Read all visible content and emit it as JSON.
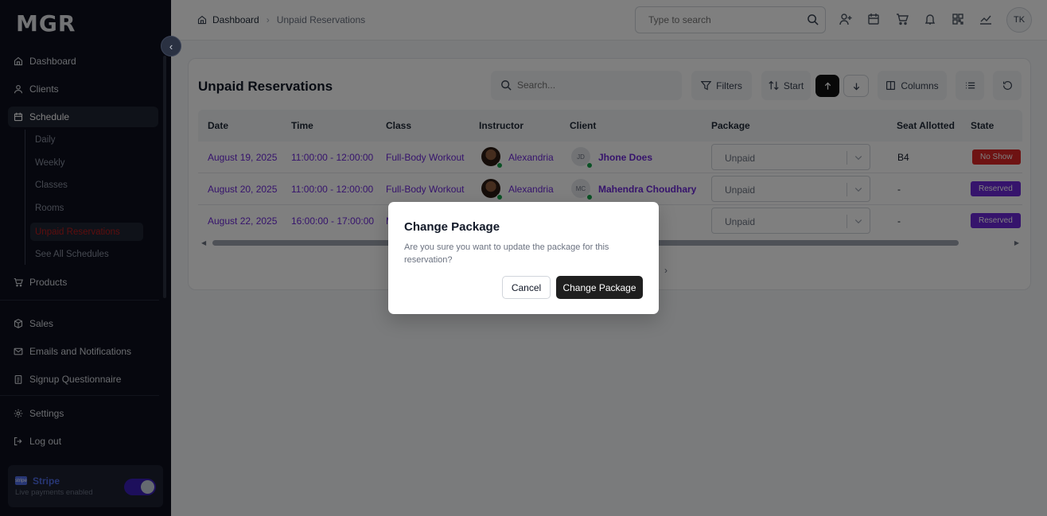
{
  "app": {
    "logo": "MGR"
  },
  "sidebar": {
    "items": [
      {
        "label": "Dashboard",
        "icon": "home-icon"
      },
      {
        "label": "Clients",
        "icon": "user-icon"
      },
      {
        "label": "Schedule",
        "icon": "calendar-icon"
      },
      {
        "label": "Products",
        "icon": "cart-icon"
      },
      {
        "label": "Sales",
        "icon": "box-icon"
      },
      {
        "label": "Emails and Notifications",
        "icon": "mail-icon"
      },
      {
        "label": "Signup Questionnaire",
        "icon": "clipboard-icon"
      },
      {
        "label": "Settings",
        "icon": "gear-icon"
      },
      {
        "label": "Log out",
        "icon": "logout-icon"
      }
    ],
    "schedule_sub": [
      "Daily",
      "Weekly",
      "Classes",
      "Rooms",
      "Unpaid Reservations",
      "See All Schedules"
    ],
    "stripe": {
      "badge": "stripe",
      "title": "Stripe",
      "subtitle": "Live payments enabled",
      "enabled": true
    }
  },
  "header": {
    "breadcrumb": {
      "root": "Dashboard",
      "current": "Unpaid Reservations"
    },
    "search_placeholder": "Type to search",
    "avatar_initials": "TK"
  },
  "main": {
    "title": "Unpaid Reservations",
    "search_placeholder": "Search...",
    "toolbar": {
      "filters": "Filters",
      "sort": "Start",
      "columns": "Columns"
    },
    "columns": [
      "Date",
      "Time",
      "Class",
      "Instructor",
      "Client",
      "Package",
      "Seat Allotted",
      "State"
    ],
    "rows": [
      {
        "date": "August 19, 2025",
        "time": "11:00:00 - 12:00:00",
        "class": "Full-Body Workout",
        "instructor": "Alexandria",
        "client_initials": "JD",
        "client": "Jhone Does",
        "package": "Unpaid",
        "seat": "B4",
        "state": "No Show",
        "state_color": "#dc2626"
      },
      {
        "date": "August 20, 2025",
        "time": "11:00:00 - 12:00:00",
        "class": "Full-Body Workout",
        "instructor": "Alexandria",
        "client_initials": "MC",
        "client": "Mahendra Choudhary",
        "package": "Unpaid",
        "seat": "-",
        "state": "Reserved",
        "state_color": "#6d28d9"
      },
      {
        "date": "August 22, 2025",
        "time": "16:00:00 - 17:00:00",
        "class": "M",
        "instructor": "",
        "client_initials": "",
        "client": "",
        "package": "Unpaid",
        "seat": "-",
        "state": "Reserved",
        "state_color": "#6d28d9"
      }
    ]
  },
  "modal": {
    "title": "Change Package",
    "description": "Are you sure you want to update the package for this reservation?",
    "cancel_label": "Cancel",
    "confirm_label": "Change Package"
  }
}
